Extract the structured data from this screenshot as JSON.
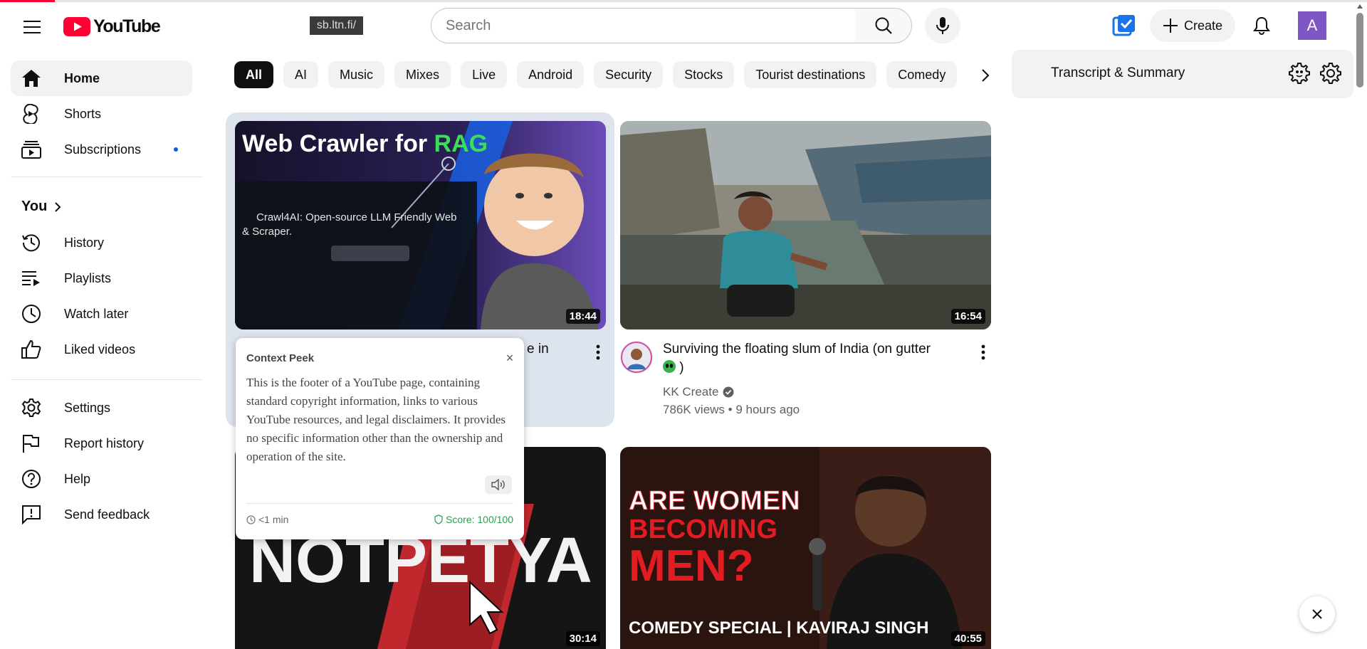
{
  "progress_percent": 4,
  "logo": {
    "text": "YouTube"
  },
  "extension_badge": "sb.ltn.fi/",
  "search": {
    "placeholder": "Search",
    "value": ""
  },
  "masthead": {
    "create_label": "Create",
    "avatar_letter": "A"
  },
  "sidebar": {
    "items_top": [
      {
        "label": "Home",
        "icon": "home-icon",
        "active": true
      },
      {
        "label": "Shorts",
        "icon": "shorts-icon"
      },
      {
        "label": "Subscriptions",
        "icon": "subscriptions-icon"
      }
    ],
    "you_label": "You",
    "items_you": [
      {
        "label": "History",
        "icon": "history-icon"
      },
      {
        "label": "Playlists",
        "icon": "playlists-icon"
      },
      {
        "label": "Watch later",
        "icon": "watch-later-icon"
      },
      {
        "label": "Liked videos",
        "icon": "thumbs-up-icon"
      }
    ],
    "items_bottom": [
      {
        "label": "Settings",
        "icon": "gear-icon"
      },
      {
        "label": "Report history",
        "icon": "flag-icon"
      },
      {
        "label": "Help",
        "icon": "help-icon"
      },
      {
        "label": "Send feedback",
        "icon": "feedback-icon"
      }
    ]
  },
  "chips": [
    "All",
    "AI",
    "Music",
    "Mixes",
    "Live",
    "Android",
    "Security",
    "Stocks",
    "Tourist destinations",
    "Comedy"
  ],
  "videos": [
    {
      "thumb_title_a": "Web Crawler for ",
      "thumb_title_b": "RAG",
      "thumb_heading": "Crawl4AI: Open-source LLM Friendly Web",
      "thumb_heading2": "& Scraper.",
      "duration": "18:44",
      "title_visible": "e in"
    },
    {
      "duration": "16:54",
      "title_line1": "Surviving the floating slum of India (on gutter",
      "title_line2": ")",
      "channel": "KK Create",
      "meta": "786K views • 9 hours ago"
    },
    {
      "thumb_text": "NOTPETYA",
      "duration": "30:14"
    },
    {
      "thumb_line1": "ARE WOMEN",
      "thumb_line2": "BECOMING",
      "thumb_line3": "MEN?",
      "thumb_footer": "COMEDY SPECIAL | KAVIRAJ SINGH",
      "duration": "40:55"
    }
  ],
  "context_peek": {
    "title": "Context Peek",
    "close": "×",
    "body": "This is the footer of a YouTube page, containing standard copyright information, links to various YouTube resources, and legal disclaimers. It provides no specific information other than the ownership and operation of the site.",
    "time": "<1 min",
    "score": "Score: 100/100"
  },
  "transcript_panel": {
    "title": "Transcript & Summary"
  },
  "colors": {
    "brand_red": "#ff0033",
    "accent_blue": "#065fd4",
    "score_green": "#2e9e4f"
  }
}
